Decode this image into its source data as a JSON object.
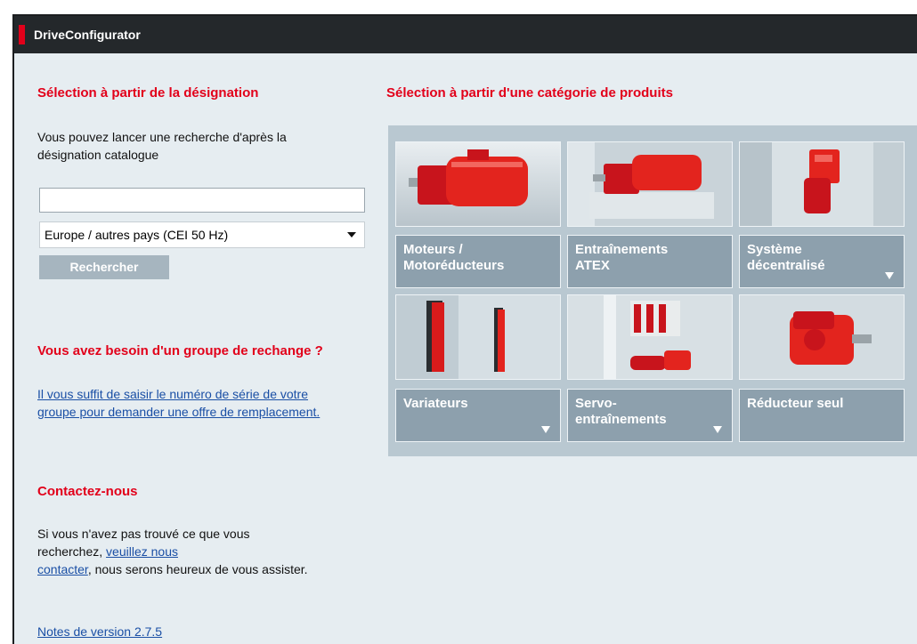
{
  "window": {
    "title": "DriveConfigurator"
  },
  "designation": {
    "heading": "Sélection à partir de la désignation",
    "intro_line1": "Vous pouvez lancer une recherche d'après la",
    "intro_line2": "désignation catalogue",
    "search_value": "",
    "region_selected": "Europe / autres pays (CEI 50 Hz)",
    "search_button": "Rechercher"
  },
  "spare": {
    "heading": "Vous avez besoin d'un groupe de rechange ?",
    "link_line1": "Il vous suffit de saisir le numéro de série de votre",
    "link_line2": "groupe pour demander une offre de remplacement."
  },
  "contact": {
    "heading": "Contactez-nous",
    "line1": "Si vous n'avez pas trouvé ce que vous",
    "line2_text": "recherchez, ",
    "line2_link": "veuillez nous",
    "line3_link": "contacter",
    "line3_text": ", nous serons heureux de vous assister."
  },
  "release_notes": "Notes de version 2.7.5",
  "categories": {
    "heading": "Sélection à partir d'une catégorie de produits",
    "items": [
      {
        "line1": "Moteurs /",
        "line2": "Motoréducteurs",
        "has_dropdown": false
      },
      {
        "line1": "Entraînements",
        "line2": "ATEX",
        "has_dropdown": false
      },
      {
        "line1": "Système",
        "line2": "décentralisé",
        "has_dropdown": true
      },
      {
        "line1": "Variateurs",
        "line2": "",
        "has_dropdown": true
      },
      {
        "line1": "Servo-",
        "line2": "entraînements",
        "has_dropdown": true
      },
      {
        "line1": "Réducteur seul",
        "line2": "",
        "has_dropdown": false
      }
    ]
  },
  "colors": {
    "accent": "#e2001a",
    "titlebar": "#24282b",
    "panel": "#b9c8d1",
    "caption": "#8da0ad",
    "background": "#e6edf1",
    "link": "#1a4fa5"
  }
}
